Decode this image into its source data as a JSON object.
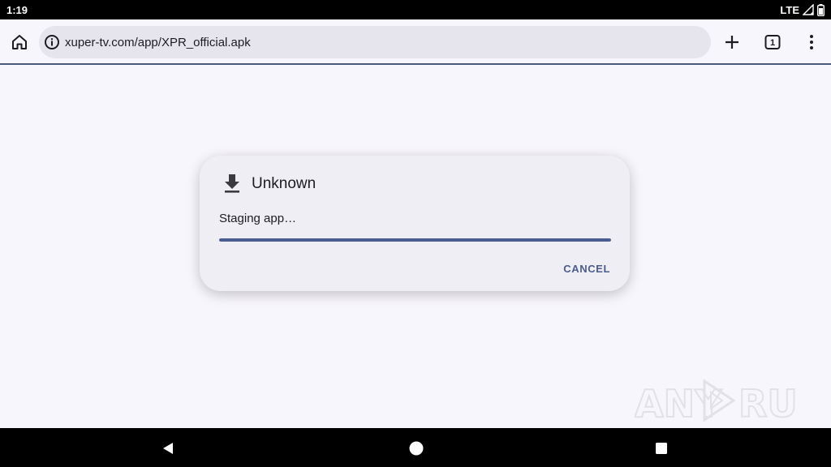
{
  "status_bar": {
    "time": "1:19",
    "network": "LTE"
  },
  "browser": {
    "url": "xuper-tv.com/app/XPR_official.apk",
    "tab_count": "1"
  },
  "dialog": {
    "title": "Unknown",
    "message": "Staging app…",
    "progress": 1.0,
    "cancel_label": "CANCEL"
  },
  "watermark": {
    "left_text": "ANY",
    "right_text": "RUN"
  },
  "icons": {
    "home": "home-icon",
    "info": "info-icon",
    "add_tab": "plus-icon",
    "tabs": "tab-switcher-icon",
    "menu": "more-vert-icon",
    "download": "download-icon",
    "nav_back": "back-triangle-icon",
    "nav_home": "home-circle-icon",
    "nav_recent": "recent-square-icon",
    "signal": "signal-icon",
    "battery": "battery-icon"
  },
  "colors": {
    "accent": "#4b5c8e",
    "dialog_bg": "#efeef5",
    "page_bg": "#f7f6fc",
    "url_bg": "#e6e5ee"
  }
}
